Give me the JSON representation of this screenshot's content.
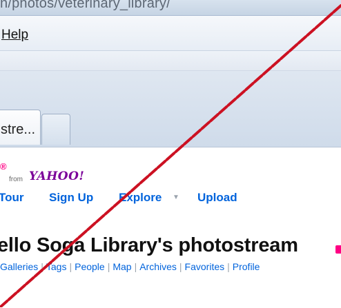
{
  "browser": {
    "address_fragment": "n/photos/veterinary_library/",
    "menu_help": "Help",
    "active_tab_label": "stre..."
  },
  "page": {
    "logo": {
      "mark": "®",
      "from": "from",
      "yahoo": "YAHOO!"
    },
    "nav": {
      "tour": "Tour",
      "signup": "Sign Up",
      "explore": "Explore",
      "upload": "Upload"
    },
    "title": "ello Soga Library's photostream",
    "subnav": [
      "Galleries",
      "Tags",
      "People",
      "Map",
      "Archives",
      "Favorites",
      "Profile"
    ]
  },
  "overlay": {
    "line_color": "#cc1122"
  }
}
